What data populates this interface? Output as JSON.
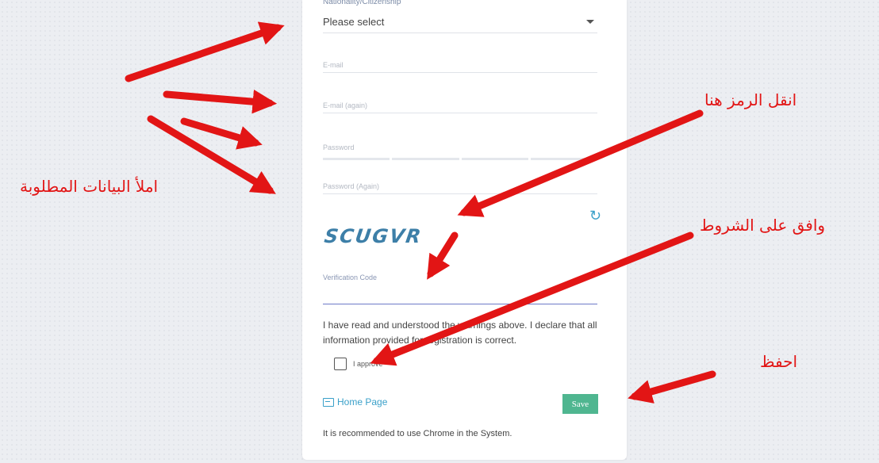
{
  "form": {
    "nationality_label": "Nationality/Citizenship",
    "nationality_value": "Please select",
    "email_placeholder": "E-mail",
    "email_again_placeholder": "E-mail (again)",
    "password_placeholder": "Password",
    "password_again_placeholder": "Password (Again)",
    "captcha_text": "SCUGVR",
    "verification_label": "Verification Code",
    "disclaimer": "I have read and understood the warnings above. I declare that all information provided for registration is correct.",
    "approve_label": "I approve",
    "home_link": "Home Page",
    "save_label": "Save",
    "recommendation": "It is recommended to use Chrome in the System."
  },
  "annotations": {
    "fill_data": "املأ البيانات المطلوبة",
    "copy_code": "انقل الرمز هنا",
    "agree_terms": "وافق على الشروط",
    "save": "احفظ"
  },
  "colors": {
    "arrow": "#e21515",
    "save_button": "#4fb690",
    "link": "#3aa0c9"
  }
}
